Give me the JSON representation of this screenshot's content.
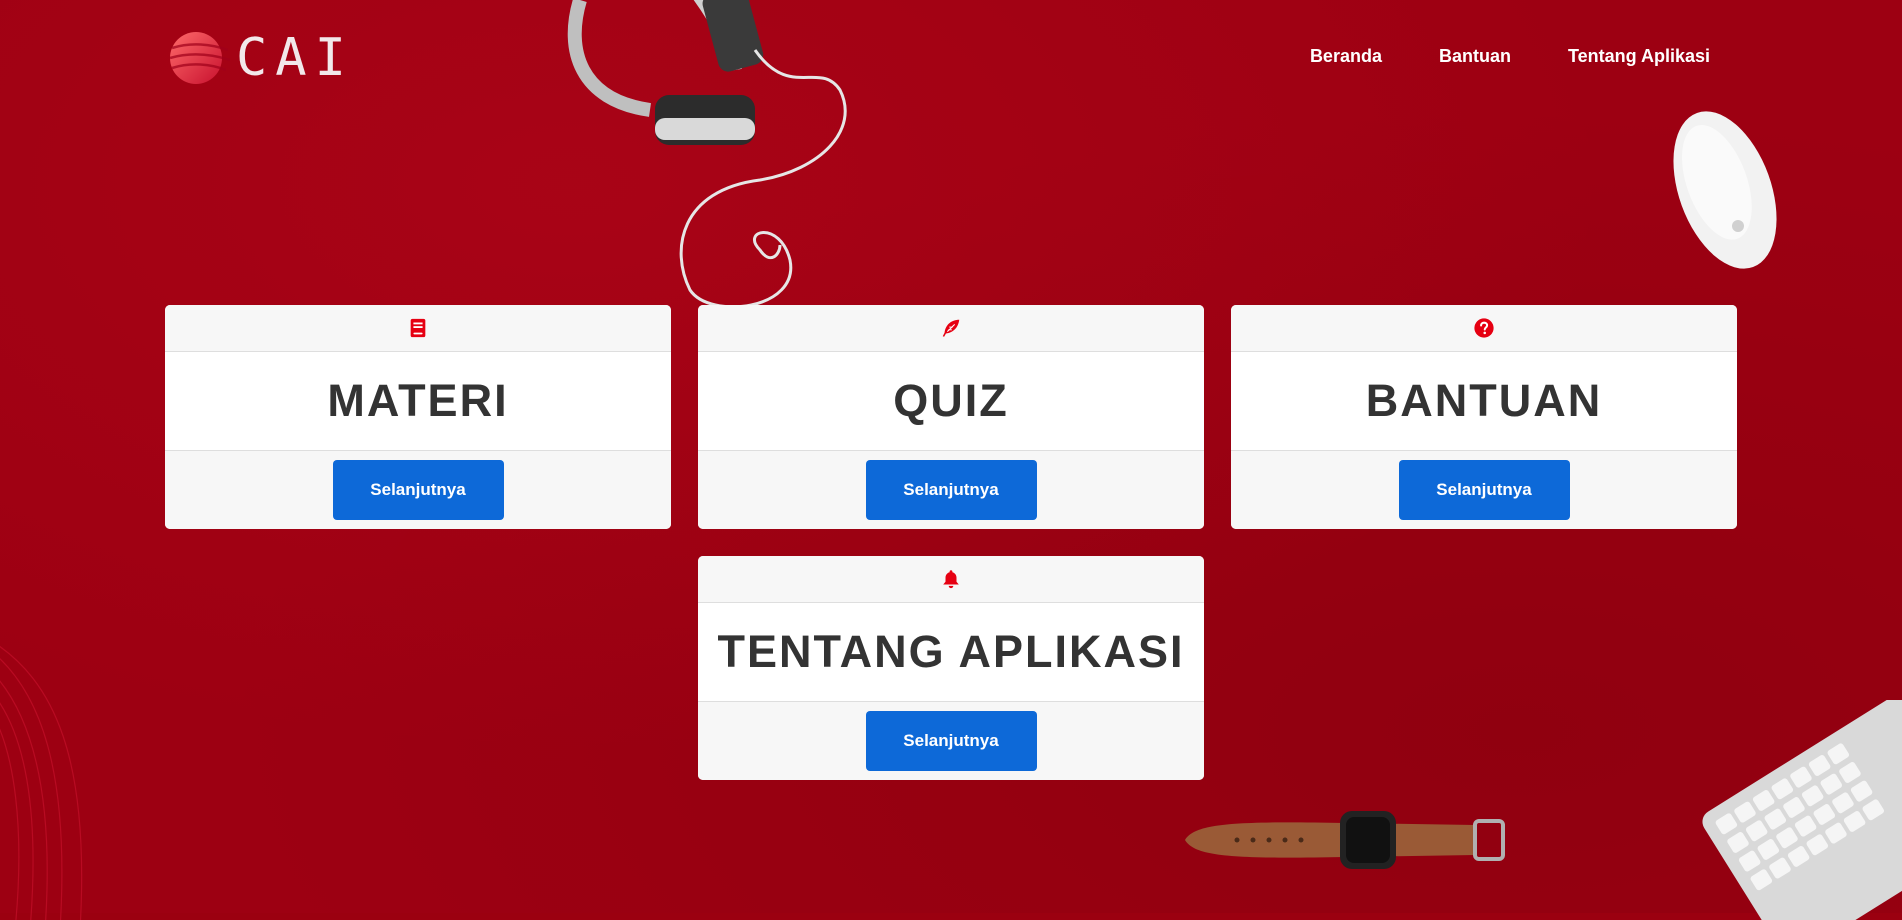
{
  "brand": {
    "name": "CAI"
  },
  "nav": {
    "items": [
      {
        "label": "Beranda"
      },
      {
        "label": "Bantuan"
      },
      {
        "label": "Tentang Aplikasi"
      }
    ]
  },
  "cards": [
    {
      "icon": "book-icon",
      "title": "MATERI",
      "button_label": "Selanjutnya"
    },
    {
      "icon": "feather-icon",
      "title": "QUIZ",
      "button_label": "Selanjutnya"
    },
    {
      "icon": "question-circle-icon",
      "title": "BANTUAN",
      "button_label": "Selanjutnya"
    },
    {
      "icon": "bell-icon",
      "title": "TENTANG APLIKASI",
      "button_label": "Selanjutnya"
    }
  ],
  "colors": {
    "background": "#9d0012",
    "icon": "#e60012",
    "button": "#0d69d8",
    "card_title": "#333333"
  }
}
